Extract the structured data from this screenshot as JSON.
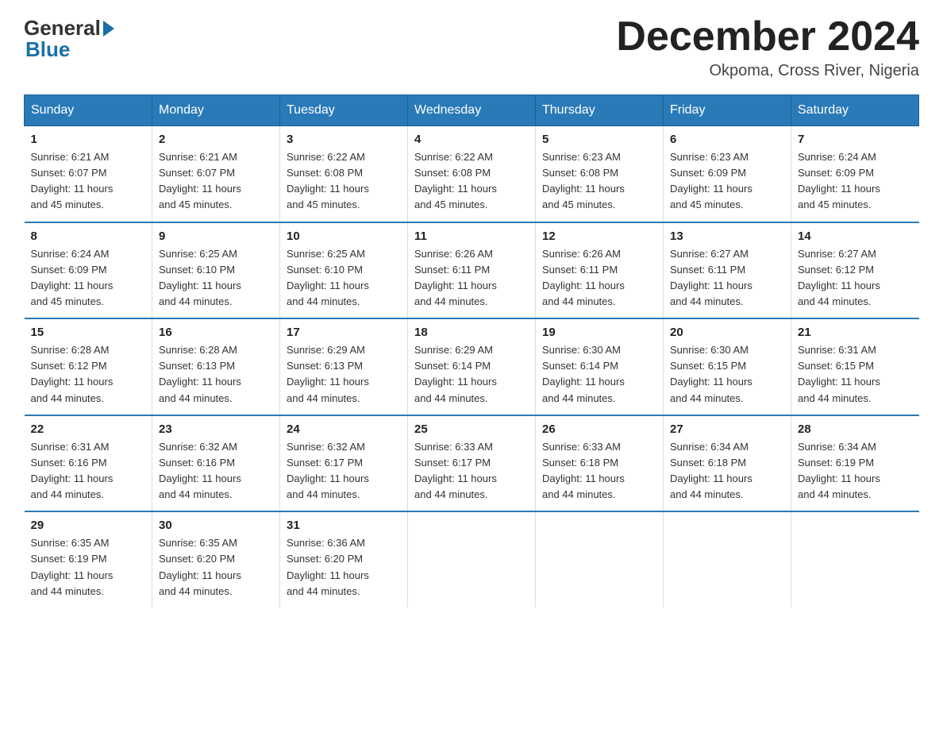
{
  "header": {
    "logo_general": "General",
    "logo_blue": "Blue",
    "month_title": "December 2024",
    "location": "Okpoma, Cross River, Nigeria"
  },
  "days_of_week": [
    "Sunday",
    "Monday",
    "Tuesday",
    "Wednesday",
    "Thursday",
    "Friday",
    "Saturday"
  ],
  "weeks": [
    [
      {
        "day": "1",
        "sunrise": "6:21 AM",
        "sunset": "6:07 PM",
        "daylight": "11 hours and 45 minutes."
      },
      {
        "day": "2",
        "sunrise": "6:21 AM",
        "sunset": "6:07 PM",
        "daylight": "11 hours and 45 minutes."
      },
      {
        "day": "3",
        "sunrise": "6:22 AM",
        "sunset": "6:08 PM",
        "daylight": "11 hours and 45 minutes."
      },
      {
        "day": "4",
        "sunrise": "6:22 AM",
        "sunset": "6:08 PM",
        "daylight": "11 hours and 45 minutes."
      },
      {
        "day": "5",
        "sunrise": "6:23 AM",
        "sunset": "6:08 PM",
        "daylight": "11 hours and 45 minutes."
      },
      {
        "day": "6",
        "sunrise": "6:23 AM",
        "sunset": "6:09 PM",
        "daylight": "11 hours and 45 minutes."
      },
      {
        "day": "7",
        "sunrise": "6:24 AM",
        "sunset": "6:09 PM",
        "daylight": "11 hours and 45 minutes."
      }
    ],
    [
      {
        "day": "8",
        "sunrise": "6:24 AM",
        "sunset": "6:09 PM",
        "daylight": "11 hours and 45 minutes."
      },
      {
        "day": "9",
        "sunrise": "6:25 AM",
        "sunset": "6:10 PM",
        "daylight": "11 hours and 44 minutes."
      },
      {
        "day": "10",
        "sunrise": "6:25 AM",
        "sunset": "6:10 PM",
        "daylight": "11 hours and 44 minutes."
      },
      {
        "day": "11",
        "sunrise": "6:26 AM",
        "sunset": "6:11 PM",
        "daylight": "11 hours and 44 minutes."
      },
      {
        "day": "12",
        "sunrise": "6:26 AM",
        "sunset": "6:11 PM",
        "daylight": "11 hours and 44 minutes."
      },
      {
        "day": "13",
        "sunrise": "6:27 AM",
        "sunset": "6:11 PM",
        "daylight": "11 hours and 44 minutes."
      },
      {
        "day": "14",
        "sunrise": "6:27 AM",
        "sunset": "6:12 PM",
        "daylight": "11 hours and 44 minutes."
      }
    ],
    [
      {
        "day": "15",
        "sunrise": "6:28 AM",
        "sunset": "6:12 PM",
        "daylight": "11 hours and 44 minutes."
      },
      {
        "day": "16",
        "sunrise": "6:28 AM",
        "sunset": "6:13 PM",
        "daylight": "11 hours and 44 minutes."
      },
      {
        "day": "17",
        "sunrise": "6:29 AM",
        "sunset": "6:13 PM",
        "daylight": "11 hours and 44 minutes."
      },
      {
        "day": "18",
        "sunrise": "6:29 AM",
        "sunset": "6:14 PM",
        "daylight": "11 hours and 44 minutes."
      },
      {
        "day": "19",
        "sunrise": "6:30 AM",
        "sunset": "6:14 PM",
        "daylight": "11 hours and 44 minutes."
      },
      {
        "day": "20",
        "sunrise": "6:30 AM",
        "sunset": "6:15 PM",
        "daylight": "11 hours and 44 minutes."
      },
      {
        "day": "21",
        "sunrise": "6:31 AM",
        "sunset": "6:15 PM",
        "daylight": "11 hours and 44 minutes."
      }
    ],
    [
      {
        "day": "22",
        "sunrise": "6:31 AM",
        "sunset": "6:16 PM",
        "daylight": "11 hours and 44 minutes."
      },
      {
        "day": "23",
        "sunrise": "6:32 AM",
        "sunset": "6:16 PM",
        "daylight": "11 hours and 44 minutes."
      },
      {
        "day": "24",
        "sunrise": "6:32 AM",
        "sunset": "6:17 PM",
        "daylight": "11 hours and 44 minutes."
      },
      {
        "day": "25",
        "sunrise": "6:33 AM",
        "sunset": "6:17 PM",
        "daylight": "11 hours and 44 minutes."
      },
      {
        "day": "26",
        "sunrise": "6:33 AM",
        "sunset": "6:18 PM",
        "daylight": "11 hours and 44 minutes."
      },
      {
        "day": "27",
        "sunrise": "6:34 AM",
        "sunset": "6:18 PM",
        "daylight": "11 hours and 44 minutes."
      },
      {
        "day": "28",
        "sunrise": "6:34 AM",
        "sunset": "6:19 PM",
        "daylight": "11 hours and 44 minutes."
      }
    ],
    [
      {
        "day": "29",
        "sunrise": "6:35 AM",
        "sunset": "6:19 PM",
        "daylight": "11 hours and 44 minutes."
      },
      {
        "day": "30",
        "sunrise": "6:35 AM",
        "sunset": "6:20 PM",
        "daylight": "11 hours and 44 minutes."
      },
      {
        "day": "31",
        "sunrise": "6:36 AM",
        "sunset": "6:20 PM",
        "daylight": "11 hours and 44 minutes."
      },
      null,
      null,
      null,
      null
    ]
  ],
  "labels": {
    "sunrise": "Sunrise:",
    "sunset": "Sunset:",
    "daylight": "Daylight:"
  }
}
